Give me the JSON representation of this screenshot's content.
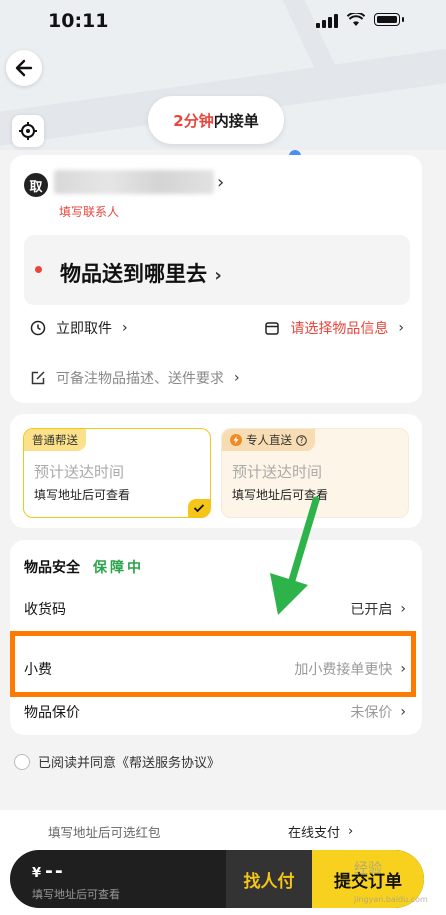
{
  "status": {
    "time": "10:11"
  },
  "map": {
    "pill_highlight": "2分钟",
    "pill_rest": "内接单"
  },
  "pickup": {
    "badge": "取",
    "chevron": "›",
    "fill_contact": "填写联系人"
  },
  "destination": {
    "text": "物品送到哪里去",
    "chevron": "›"
  },
  "pickup_time": {
    "label": "立即取件",
    "chevron": "›"
  },
  "item_info": {
    "label": "请选择物品信息",
    "chevron": "›"
  },
  "note": {
    "placeholder": "可备注物品描述、送件要求",
    "chevron": "›"
  },
  "options": [
    {
      "tag": "普通帮送",
      "eta": "预计送达时间",
      "sub": "填写地址后可查看",
      "selected": true
    },
    {
      "tag": "专人直送",
      "eta": "预计送达时间",
      "sub": "填写地址后可查看",
      "selected": false
    }
  ],
  "safety": {
    "title": "物品安全",
    "badge": "保障中"
  },
  "rows": {
    "receipt_code": {
      "label": "收货码",
      "value": "已开启",
      "chevron": "›"
    },
    "tip": {
      "label": "小费",
      "value": "加小费接单更快",
      "chevron": "›"
    },
    "insurance": {
      "label": "物品保价",
      "value": "未保价",
      "chevron": "›"
    }
  },
  "agreement": {
    "text": "已阅读并同意《帮送服务协议》"
  },
  "bottom": {
    "coupon": "填写地址后可选红包",
    "payment": "在线支付",
    "payment_chevron": "›",
    "currency": "¥",
    "price": "--",
    "price_hint": "填写地址后可查看",
    "find_pay": "找人付",
    "submit": "提交订单"
  },
  "watermark": {
    "text": "经验",
    "url": "jingyan.baidu.com"
  },
  "colors": {
    "accent_red": "#e8453c",
    "brand_yellow": "#f7d11e",
    "highlight_orange": "#ff7a00",
    "safe_green": "#2aa44a"
  }
}
